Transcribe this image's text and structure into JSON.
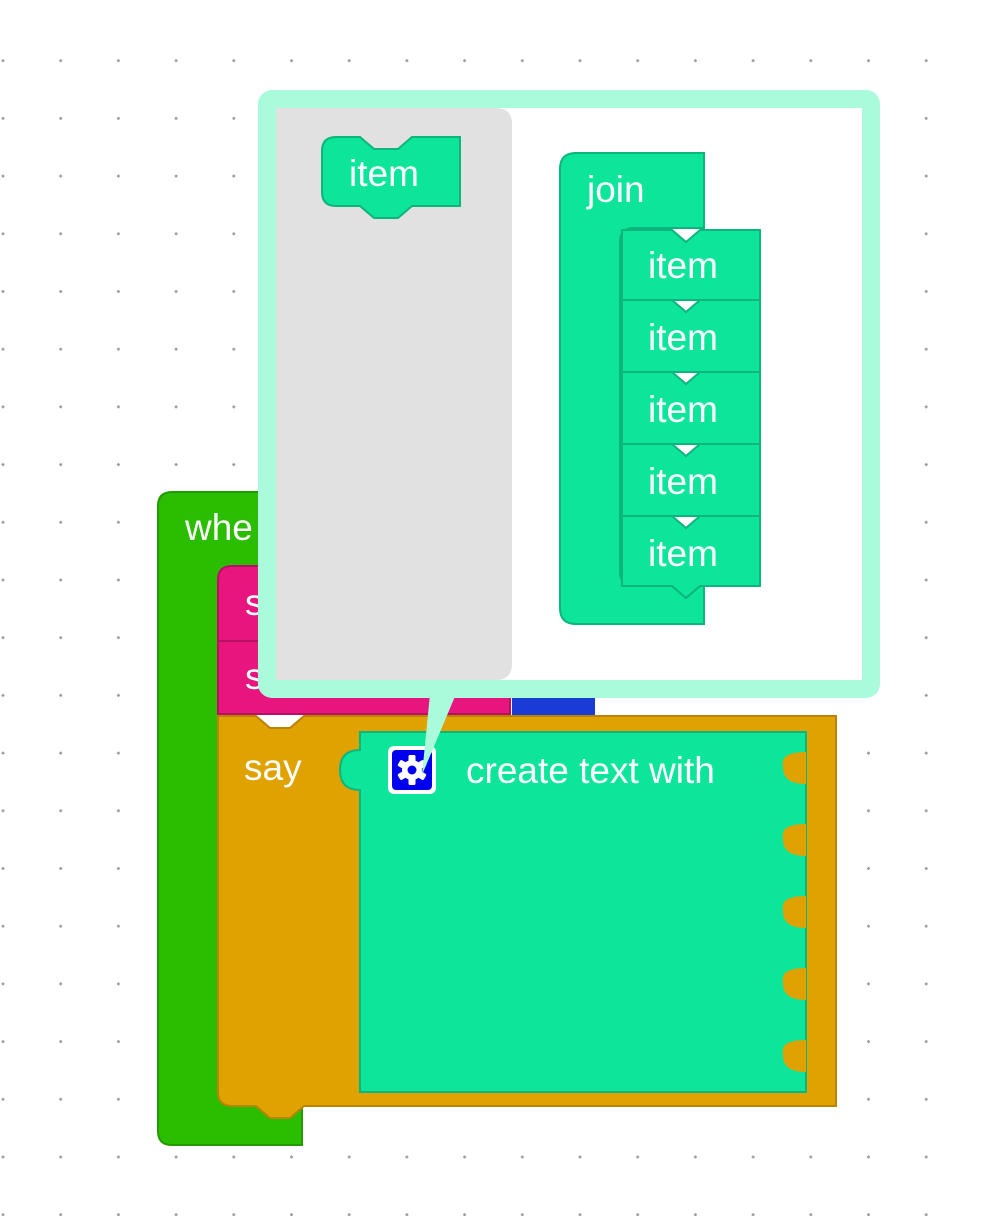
{
  "workspace": {
    "grid": "dotted-plus"
  },
  "blocks": {
    "event_label": "whe",
    "set1_label": "s",
    "set2_label": "s",
    "say_label": "say",
    "create_text_label": "create text with"
  },
  "mutator": {
    "flyout_item_label": "item",
    "join_label": "join",
    "items": [
      "item",
      "item",
      "item",
      "item",
      "item"
    ]
  },
  "icons": {
    "mutator": "gear-icon"
  },
  "colors": {
    "event_green": "#2bbd00",
    "set_pink": "#e8157f",
    "var_blue": "#1a3bd6",
    "say_orange": "#e0a200",
    "text_teal": "#0de59b",
    "bubble_mint": "#a9fbdc",
    "flyout_gray": "#e1e1e1"
  }
}
